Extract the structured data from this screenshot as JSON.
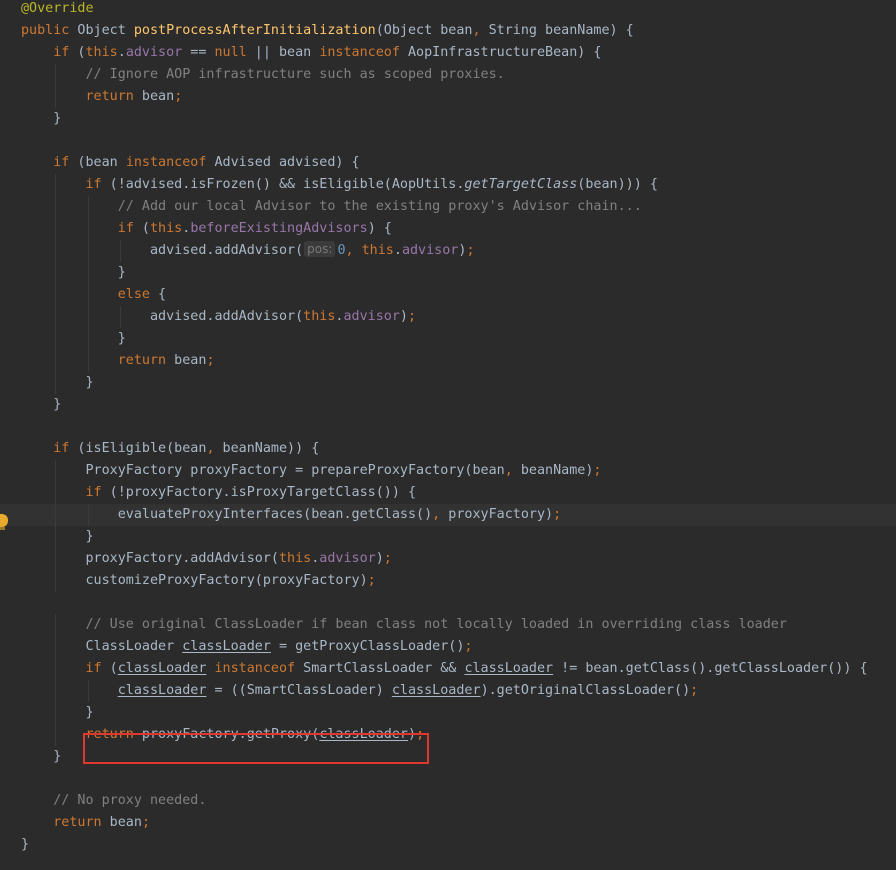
{
  "editor": {
    "param_hint_label": "pos:",
    "lines": [
      "@Override",
      "public Object postProcessAfterInitialization(Object bean, String beanName) {",
      "    if (this.advisor == null || bean instanceof AopInfrastructureBean) {",
      "        // Ignore AOP infrastructure such as scoped proxies.",
      "        return bean;",
      "    }",
      "",
      "    if (bean instanceof Advised advised) {",
      "        if (!advised.isFrozen() && isEligible(AopUtils.getTargetClass(bean))) {",
      "            // Add our local Advisor to the existing proxy's Advisor chain...",
      "            if (this.beforeExistingAdvisors) {",
      "                advised.addAdvisor(pos: 0, this.advisor);",
      "            }",
      "            else {",
      "                advised.addAdvisor(this.advisor);",
      "            }",
      "            return bean;",
      "        }",
      "    }",
      "",
      "    if (isEligible(bean, beanName)) {",
      "        ProxyFactory proxyFactory = prepareProxyFactory(bean, beanName);",
      "        if (!proxyFactory.isProxyTargetClass()) {",
      "            evaluateProxyInterfaces(bean.getClass(), proxyFactory);",
      "        }",
      "        proxyFactory.addAdvisor(this.advisor);",
      "        customizeProxyFactory(proxyFactory);",
      "",
      "        // Use original ClassLoader if bean class not locally loaded in overriding class loader",
      "        ClassLoader classLoader = getProxyClassLoader();",
      "        if (classLoader instanceof SmartClassLoader && classLoader != bean.getClass().getClassLoader()) {",
      "            classLoader = ((SmartClassLoader) classLoader).getOriginalClassLoader();",
      "        }",
      "        return proxyFactory.getProxy(classLoader);",
      "    }",
      "",
      "    // No proxy needed.",
      "    return bean;",
      "}"
    ]
  },
  "colors": {
    "background": "#2b2b2b",
    "current_line": "#323232",
    "default_text": "#a9b7c6",
    "keyword": "#cc7832",
    "annotation": "#bbb529",
    "method_declaration": "#ffc66d",
    "field": "#9876aa",
    "number": "#6897bb",
    "comment": "#808080",
    "highlight_box": "#e0372f",
    "intention_bulb": "#e8a92c"
  },
  "icons": {
    "gutter_intention": "lightbulb-icon"
  }
}
